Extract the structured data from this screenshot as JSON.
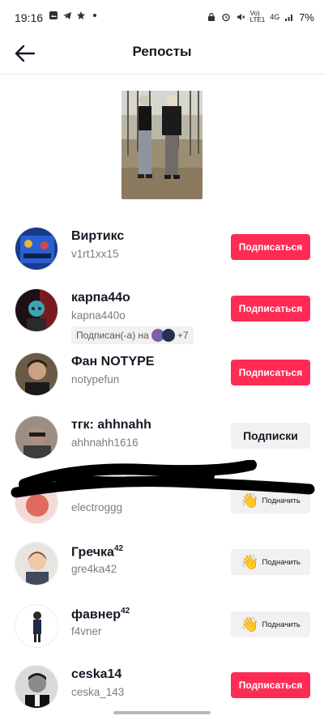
{
  "status_bar": {
    "time": "19:16",
    "battery": "7%",
    "net_top": "Vo)",
    "net_bottom": "LTE1",
    "net_gen": "4G"
  },
  "header": {
    "title": "Репосты"
  },
  "colors": {
    "follow_button": "#fe2c55",
    "secondary_button": "#f1f1f2",
    "handle_text": "#7d7d82"
  },
  "users": [
    {
      "name": "Виртикс",
      "handle": "v1rt1xx15",
      "button": "Подписаться",
      "button_type": "follow"
    },
    {
      "name": "карпа44о",
      "handle": "kapna440o",
      "button": "Подписаться",
      "button_type": "follow",
      "mutual": {
        "text": "Подписан(-а) на",
        "more": "+7"
      }
    },
    {
      "name": "Фан NOTYPE",
      "handle": "notypefun",
      "button": "Подписаться",
      "button_type": "follow"
    },
    {
      "name": "тгк: ahhnahh",
      "handle": "ahhnahh1616",
      "button": "Подписки",
      "button_type": "following"
    },
    {
      "name": "",
      "handle": "electroggg",
      "button": "Подначить",
      "button_type": "wave"
    },
    {
      "name": "Гречка",
      "name_sup": "42",
      "handle": "gre4ka42",
      "button": "Подначить",
      "button_type": "wave"
    },
    {
      "name": "фавнер",
      "name_sup": "42",
      "handle": "f4vner",
      "button": "Подначить",
      "button_type": "wave"
    },
    {
      "name": "ceska14",
      "handle": "ceska_143",
      "button": "Подписаться",
      "button_type": "follow"
    }
  ]
}
